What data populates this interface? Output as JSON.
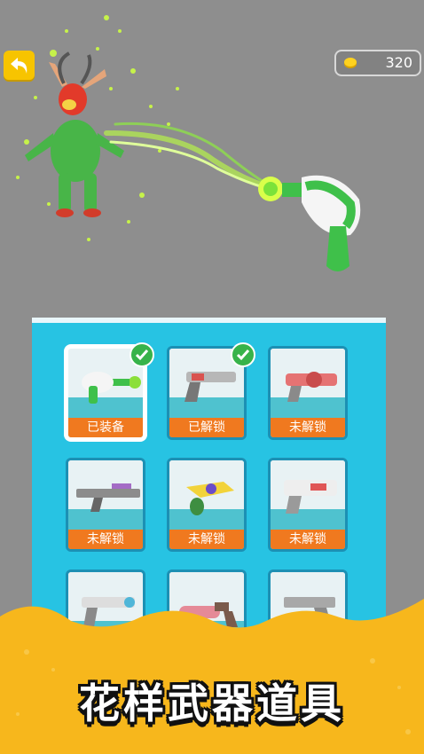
{
  "header": {
    "back_icon": "back-arrow-icon",
    "coins": "320",
    "coin_icon": "coin-icon"
  },
  "weapons": [
    {
      "label": "已装备",
      "state": "equipped",
      "checked": true
    },
    {
      "label": "已解锁",
      "state": "unlocked",
      "checked": true
    },
    {
      "label": "未解锁",
      "state": "locked",
      "checked": false
    },
    {
      "label": "未解锁",
      "state": "locked",
      "checked": false
    },
    {
      "label": "未解锁",
      "state": "locked",
      "checked": false
    },
    {
      "label": "未解锁",
      "state": "locked",
      "checked": false
    },
    {
      "label": "",
      "state": "partial",
      "checked": false
    },
    {
      "label": "",
      "state": "partial",
      "checked": false
    },
    {
      "label": "",
      "state": "partial",
      "checked": false
    }
  ],
  "banner": {
    "title": "花样武器道具"
  },
  "colors": {
    "accent": "#f7c400",
    "panel": "#27c3e3",
    "label": "#f0791f",
    "banner": "#f7b71c"
  }
}
